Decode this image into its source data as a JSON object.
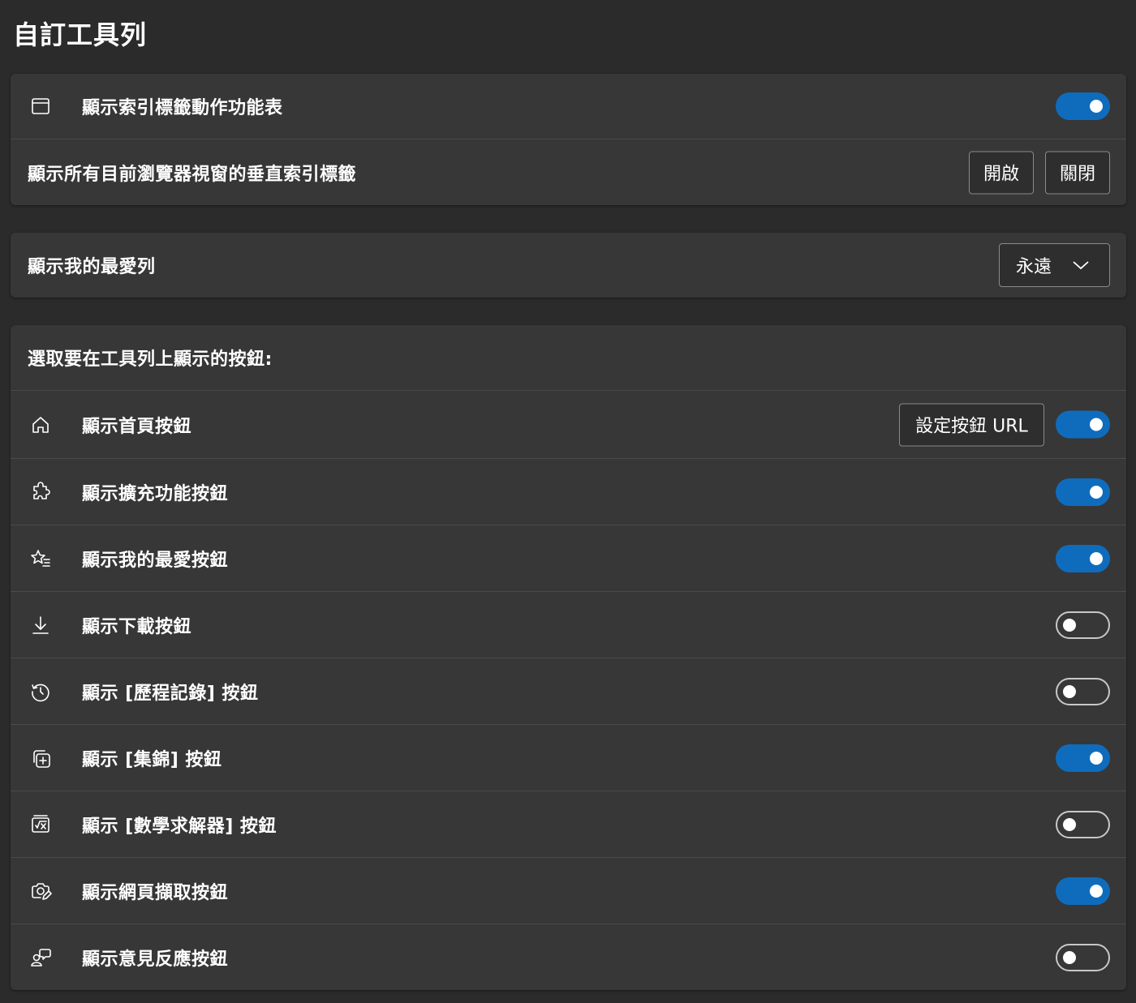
{
  "page_title": "自訂工具列",
  "card1": {
    "tab_actions_label": "顯示索引標籤動作功能表",
    "tab_actions_on": true,
    "vertical_tabs_label": "顯示所有目前瀏覽器視窗的垂直索引標籤",
    "open_button": "開啟",
    "close_button": "關閉"
  },
  "card2": {
    "favorites_bar_label": "顯示我的最愛列",
    "favorites_bar_value": "永遠"
  },
  "card3": {
    "header": "選取要在工具列上顯示的按鈕:",
    "set_url_button": "設定按鈕 URL",
    "items": [
      {
        "label": "顯示首頁按鈕",
        "icon": "home-icon",
        "on": true
      },
      {
        "label": "顯示擴充功能按鈕",
        "icon": "puzzle-icon",
        "on": true
      },
      {
        "label": "顯示我的最愛按鈕",
        "icon": "favorites-icon",
        "on": true
      },
      {
        "label": "顯示下載按鈕",
        "icon": "download-icon",
        "on": false
      },
      {
        "label": "顯示 [歷程記錄] 按鈕",
        "icon": "history-icon",
        "on": false
      },
      {
        "label": "顯示 [集錦] 按鈕",
        "icon": "collections-icon",
        "on": true
      },
      {
        "label": "顯示 [數學求解器] 按鈕",
        "icon": "math-solver-icon",
        "on": false
      },
      {
        "label": "顯示網頁擷取按鈕",
        "icon": "web-capture-icon",
        "on": true
      },
      {
        "label": "顯示意見反應按鈕",
        "icon": "feedback-icon",
        "on": false
      }
    ]
  },
  "colors": {
    "background": "#2b2b2b",
    "card": "#373737",
    "toggle_on": "#0f6cbd"
  }
}
